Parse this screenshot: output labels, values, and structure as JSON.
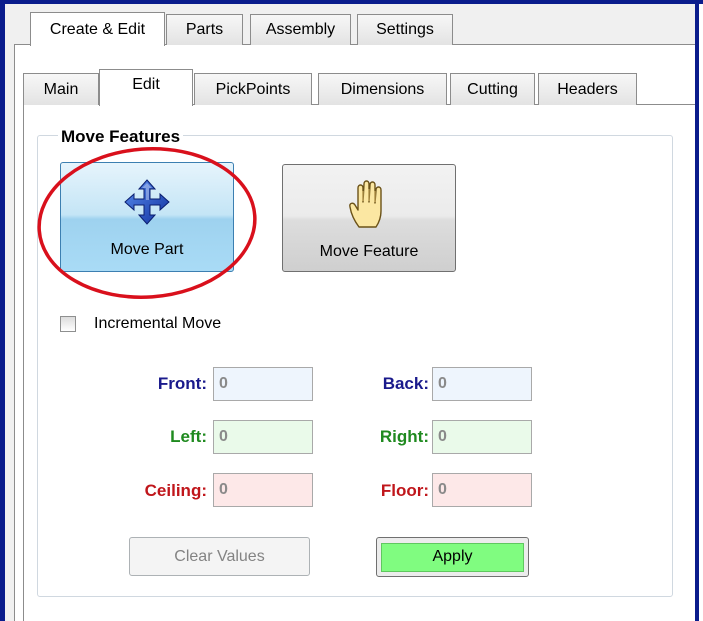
{
  "top_tabs": [
    {
      "label": "Create & Edit",
      "active": true
    },
    {
      "label": "Parts",
      "active": false
    },
    {
      "label": "Assembly",
      "active": false
    },
    {
      "label": "Settings",
      "active": false
    }
  ],
  "sub_tabs": [
    {
      "label": "Main",
      "active": false
    },
    {
      "label": "Edit",
      "active": true
    },
    {
      "label": "PickPoints",
      "active": false
    },
    {
      "label": "Dimensions",
      "active": false
    },
    {
      "label": "Cutting",
      "active": false
    },
    {
      "label": "Headers",
      "active": false
    }
  ],
  "group": {
    "title": "Move Features"
  },
  "buttons": {
    "move_part": {
      "label": "Move Part",
      "icon": "move-arrows-icon",
      "selected": true
    },
    "move_feature": {
      "label": "Move Feature",
      "icon": "hand-icon"
    }
  },
  "incremental": {
    "label": "Incremental Move",
    "checked": false
  },
  "fields": {
    "front": {
      "label": "Front:",
      "value": "0"
    },
    "back": {
      "label": "Back:",
      "value": "0"
    },
    "left": {
      "label": "Left:",
      "value": "0"
    },
    "right": {
      "label": "Right:",
      "value": "0"
    },
    "ceiling": {
      "label": "Ceiling:",
      "value": "0"
    },
    "floor": {
      "label": "Floor:",
      "value": "0"
    }
  },
  "actions": {
    "clear_label": "Clear Values",
    "apply_label": "Apply"
  },
  "colors": {
    "window_frame": "#0a1c8c",
    "annotation_circle": "#d9101c",
    "label_blue": "#1a1a8c",
    "label_green": "#1f8a1f",
    "label_red": "#c0161b",
    "apply_fill": "#80fc80"
  }
}
